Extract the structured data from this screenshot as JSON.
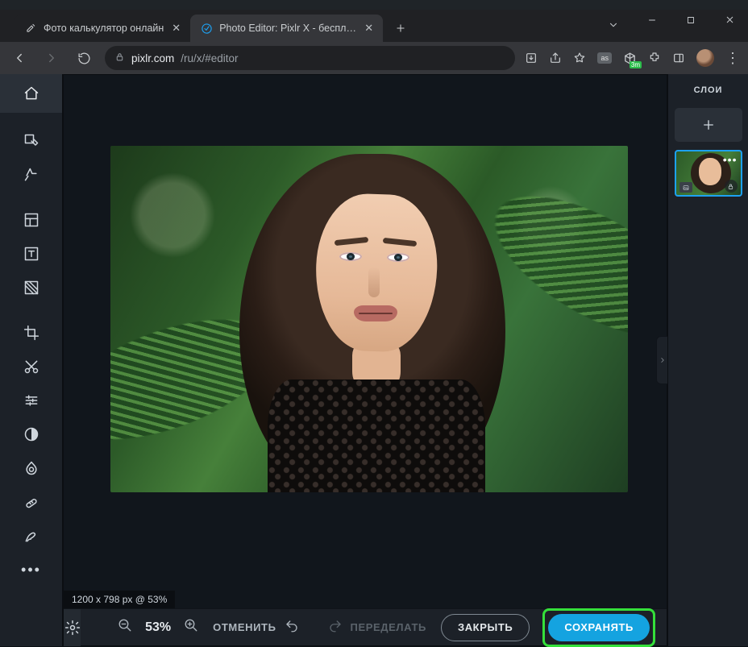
{
  "browser": {
    "tabs": [
      {
        "title": "Фото калькулятор онлайн",
        "active": false
      },
      {
        "title": "Photo Editor: Pixlr X - бесплатны",
        "active": true
      }
    ],
    "url_domain": "pixlr.com",
    "url_path": "/ru/x/#editor",
    "ext_badge": "3m"
  },
  "toolbar": {
    "tools": [
      "home",
      "arrange",
      "ai-auto",
      "layout",
      "text",
      "fill",
      "crop",
      "cut",
      "adjust",
      "contrast",
      "liquify",
      "heal",
      "draw",
      "more"
    ]
  },
  "status": {
    "canvas_info": "1200 x 798 px @ 53%"
  },
  "layers": {
    "title": "СЛОИ"
  },
  "bottom": {
    "zoom_pct": "53%",
    "undo": "ОТМЕНИТЬ",
    "redo": "ПЕРЕДЕЛАТЬ",
    "close": "ЗАКРЫТЬ",
    "save": "СОХРАНЯТЬ"
  }
}
